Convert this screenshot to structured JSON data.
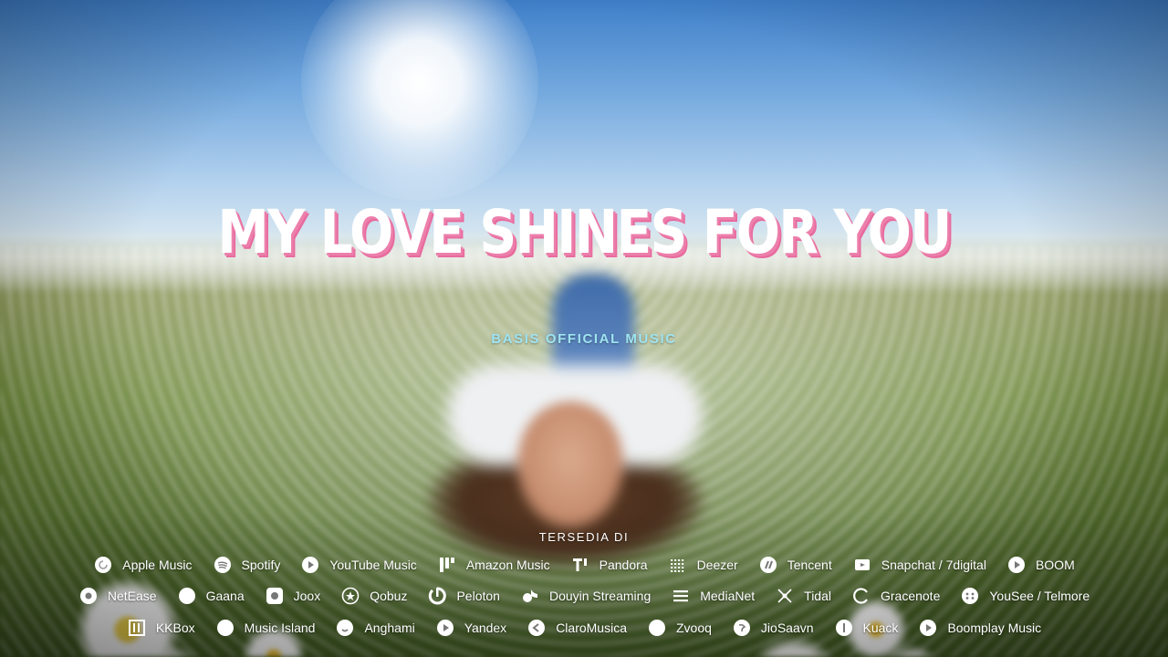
{
  "video": {
    "title": "MY LOVE SHINES FOR YOU",
    "artist": "BASIS OFFICIAL MUSIC",
    "available_label": "TERSEDIA DI"
  },
  "platform_rows": [
    [
      {
        "label": "Apple Music",
        "icon": "apple-music-icon"
      },
      {
        "label": "Spotify",
        "icon": "spotify-icon"
      },
      {
        "label": "YouTube Music",
        "icon": "youtube-music-icon"
      },
      {
        "label": "Amazon Music",
        "icon": "amazon-music-icon"
      },
      {
        "label": "Pandora",
        "icon": "pandora-icon"
      },
      {
        "label": "Deezer",
        "icon": "deezer-icon"
      },
      {
        "label": "Tencent",
        "icon": "tencent-icon"
      },
      {
        "label": "Snapchat / 7digital",
        "icon": "snapchat-7digital-icon"
      },
      {
        "label": "BOOM",
        "icon": "boom-icon"
      }
    ],
    [
      {
        "label": "NetEase",
        "icon": "netease-icon"
      },
      {
        "label": "Gaana",
        "icon": "gaana-icon"
      },
      {
        "label": "Joox",
        "icon": "joox-icon"
      },
      {
        "label": "Qobuz",
        "icon": "qobuz-icon"
      },
      {
        "label": "Peloton",
        "icon": "peloton-icon"
      },
      {
        "label": "Douyin Streaming",
        "icon": "douyin-icon"
      },
      {
        "label": "MediaNet",
        "icon": "medianet-icon"
      },
      {
        "label": "Tidal",
        "icon": "tidal-icon"
      },
      {
        "label": "Gracenote",
        "icon": "gracenote-icon"
      },
      {
        "label": "YouSee / Telmore",
        "icon": "yousee-telmore-icon"
      }
    ],
    [
      {
        "label": "KKBox",
        "icon": "kkbox-icon"
      },
      {
        "label": "Music Island",
        "icon": "music-island-icon"
      },
      {
        "label": "Anghami",
        "icon": "anghami-icon"
      },
      {
        "label": "Yandex",
        "icon": "yandex-icon"
      },
      {
        "label": "ClaroMusica",
        "icon": "claromusica-icon"
      },
      {
        "label": "Zvooq",
        "icon": "zvooq-icon"
      },
      {
        "label": "JioSaavn",
        "icon": "jiosaavn-icon"
      },
      {
        "label": "Kuack",
        "icon": "kuack-icon"
      },
      {
        "label": "Boomplay Music",
        "icon": "boomplay-music-icon"
      }
    ]
  ]
}
